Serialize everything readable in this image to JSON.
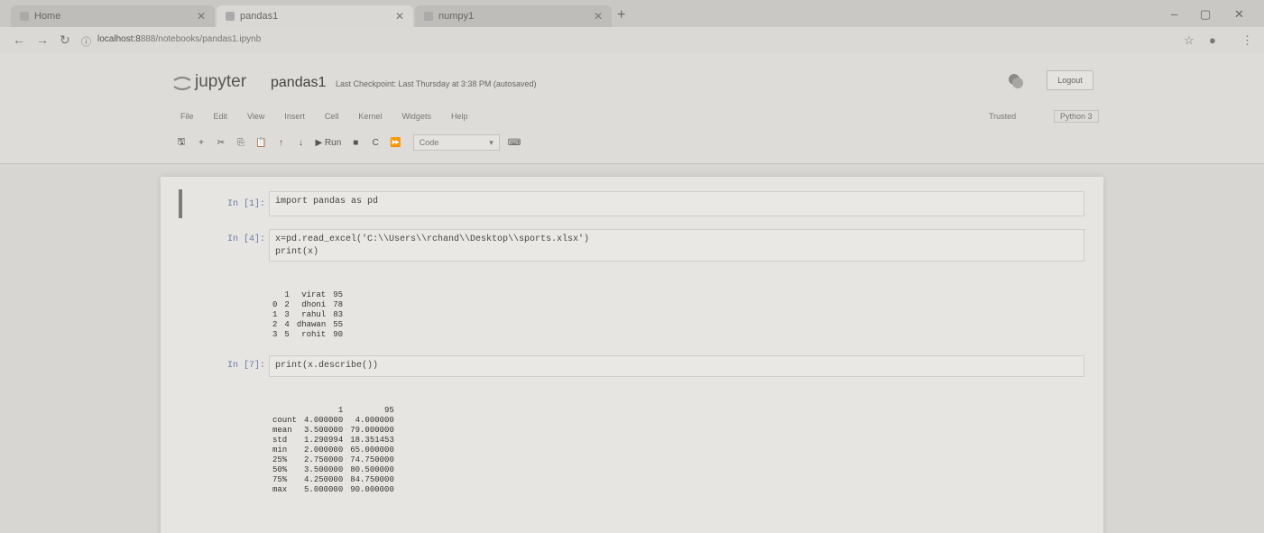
{
  "browser": {
    "tabs": [
      {
        "label": "Home",
        "active": false
      },
      {
        "label": "pandas1",
        "active": true
      },
      {
        "label": "numpy1",
        "active": false
      }
    ],
    "new_tab": "+",
    "url_host": "localhost:8",
    "url_path": "888/notebooks/pandas1.ipynb",
    "controls": {
      "minimize": "–",
      "maximize": "▢",
      "close": "✕"
    }
  },
  "jupyter": {
    "brand": "jupyter",
    "notebook_name": "pandas1",
    "checkpoint": "Last Checkpoint: Last Thursday at 3:38 PM  (autosaved)",
    "logout": "Logout",
    "menu": [
      "File",
      "Edit",
      "View",
      "Insert",
      "Cell",
      "Kernel",
      "Widgets",
      "Help"
    ],
    "trusted": "Trusted",
    "kernel_name": "Python 3",
    "toolbar": {
      "run_label": "▶ Run",
      "cell_type": "Code"
    }
  },
  "cells": [
    {
      "prompt": "In [1]:",
      "input": "import pandas as pd"
    },
    {
      "prompt": "In [4]:",
      "input": "x=pd.read_excel('C:\\\\Users\\\\rchand\\\\Desktop\\\\sports.xlsx')\nprint(x)",
      "output": {
        "header": [
          "",
          "1",
          "virat",
          "95"
        ],
        "rows": [
          [
            "0",
            "2",
            "dhoni",
            "78"
          ],
          [
            "1",
            "3",
            "rahul",
            "83"
          ],
          [
            "2",
            "4",
            "dhawan",
            "55"
          ],
          [
            "3",
            "5",
            "rohit",
            "90"
          ]
        ]
      }
    },
    {
      "prompt": "In [7]:",
      "input": "print(x.describe())",
      "output": {
        "header": [
          "",
          "1",
          "95"
        ],
        "rows": [
          [
            "count",
            "4.000000",
            "4.000000"
          ],
          [
            "mean",
            "3.500000",
            "79.000000"
          ],
          [
            "std",
            "1.290994",
            "18.351453"
          ],
          [
            "min",
            "2.000000",
            "65.000000"
          ],
          [
            "25%",
            "2.750000",
            "74.750000"
          ],
          [
            "50%",
            "3.500000",
            "80.500000"
          ],
          [
            "75%",
            "4.250000",
            "84.750000"
          ],
          [
            "max",
            "5.000000",
            "90.000000"
          ]
        ]
      }
    }
  ]
}
